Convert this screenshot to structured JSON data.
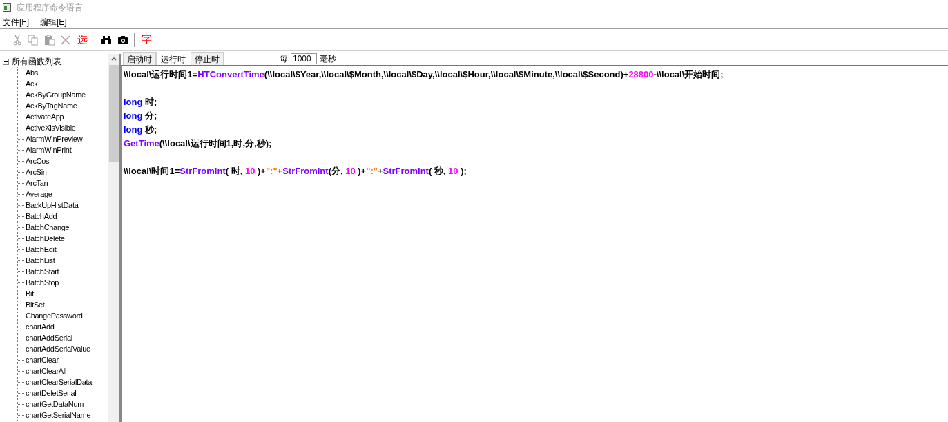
{
  "window": {
    "title": "应用程序命令语言"
  },
  "menu": [
    "文件[F]",
    "编辑[E]"
  ],
  "toolbar": [
    {
      "kind": "cut",
      "disabled": true
    },
    {
      "kind": "copy",
      "disabled": true
    },
    {
      "kind": "paste",
      "disabled": true
    },
    {
      "kind": "delete",
      "disabled": true
    },
    {
      "kind": "text",
      "label": "选",
      "disabled": false
    },
    {
      "kind": "separator"
    },
    {
      "kind": "find",
      "disabled": false
    },
    {
      "kind": "camera",
      "disabled": false
    },
    {
      "kind": "separator"
    },
    {
      "kind": "text",
      "label": "字",
      "disabled": false
    }
  ],
  "tree": {
    "label": "所有函数列表",
    "expanded": true,
    "children": [
      "Abs",
      "Ack",
      "AckByGroupName",
      "AckByTagName",
      "ActivateApp",
      "ActiveXlsVisible",
      "AlarmWinPreview",
      "AlarmWinPrint",
      "ArcCos",
      "ArcSin",
      "ArcTan",
      "Average",
      "BackUpHistData",
      "BatchAdd",
      "BatchChange",
      "BatchDelete",
      "BatchEdit",
      "BatchList",
      "BatchStart",
      "BatchStop",
      "Bit",
      "BitSet",
      "ChangePassword",
      "chartAdd",
      "chartAddSerial",
      "chartAddSerialValue",
      "chartClear",
      "chartClearAll",
      "chartClearSerialData",
      "chartDeletSerial",
      "chartGetDataNum",
      "chartGetSerialName"
    ]
  },
  "tabs": [
    {
      "label": "启动时",
      "selected": false
    },
    {
      "label": "运行时",
      "selected": true
    },
    {
      "label": "停止时",
      "selected": false
    }
  ],
  "interval": {
    "prefix": "每",
    "value": "1000",
    "unit": "毫秒"
  },
  "code": [
    {
      "kind": "code",
      "tokens": [
        {
          "kind": "plain",
          "text": "\\\\local\\运行时间1="
        },
        {
          "kind": "func",
          "text": "HTConvertTime"
        },
        {
          "kind": "plain",
          "text": "(\\\\local\\$Year,\\\\local\\$Month,\\\\local\\$Day,\\\\local\\$Hour,\\\\local\\$Minute,\\\\local\\$Second)+"
        },
        {
          "kind": "number",
          "text": "28800"
        },
        {
          "kind": "plain",
          "text": "-\\\\local\\开始时间;"
        }
      ]
    },
    {
      "kind": "blank"
    },
    {
      "kind": "code",
      "tokens": [
        {
          "kind": "keyword",
          "text": "long"
        },
        {
          "kind": "plain",
          "text": " 时;"
        }
      ]
    },
    {
      "kind": "code",
      "tokens": [
        {
          "kind": "keyword",
          "text": "long"
        },
        {
          "kind": "plain",
          "text": " 分;"
        }
      ]
    },
    {
      "kind": "code",
      "tokens": [
        {
          "kind": "keyword",
          "text": "long"
        },
        {
          "kind": "plain",
          "text": " 秒;"
        }
      ]
    },
    {
      "kind": "code",
      "tokens": [
        {
          "kind": "func",
          "text": "GetTime"
        },
        {
          "kind": "plain",
          "text": "(\\\\local\\运行时间1,时,分,秒);"
        }
      ]
    },
    {
      "kind": "blank"
    },
    {
      "kind": "code",
      "tokens": [
        {
          "kind": "plain",
          "text": "\\\\local\\时间1="
        },
        {
          "kind": "func",
          "text": "StrFromInt"
        },
        {
          "kind": "plain",
          "text": "( 时, "
        },
        {
          "kind": "number",
          "text": "10"
        },
        {
          "kind": "plain",
          "text": " )+"
        },
        {
          "kind": "string",
          "text": "\":\""
        },
        {
          "kind": "plain",
          "text": "+"
        },
        {
          "kind": "func",
          "text": "StrFromInt"
        },
        {
          "kind": "plain",
          "text": "(分, "
        },
        {
          "kind": "number",
          "text": "10"
        },
        {
          "kind": "plain",
          "text": " )+"
        },
        {
          "kind": "string",
          "text": "\":\""
        },
        {
          "kind": "plain",
          "text": "+"
        },
        {
          "kind": "func",
          "text": "StrFromInt"
        },
        {
          "kind": "plain",
          "text": "( 秒, "
        },
        {
          "kind": "number",
          "text": "10"
        },
        {
          "kind": "plain",
          "text": " );"
        }
      ]
    }
  ]
}
